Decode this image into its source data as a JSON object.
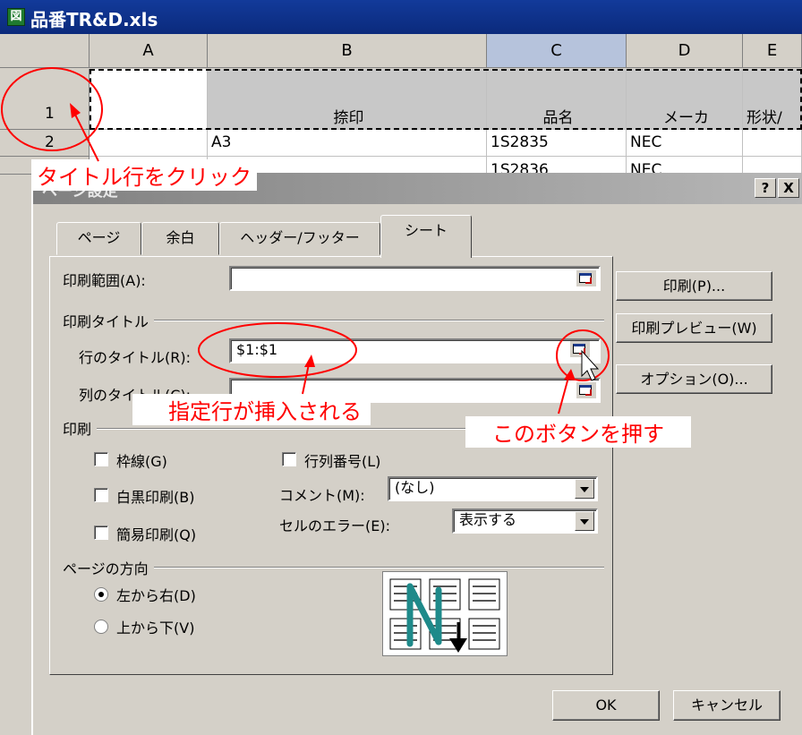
{
  "window": {
    "title": "品番TR&D.xls",
    "icon": "excel-icon"
  },
  "sheet": {
    "columns": [
      "A",
      "B",
      "C",
      "D",
      "E"
    ],
    "rows": [
      {
        "num": "1",
        "cells": [
          "",
          "捺印",
          "品名",
          "メーカ",
          "形状/"
        ]
      },
      {
        "num": "2",
        "cells": [
          "",
          "A3",
          "1S2835",
          "NEC",
          ""
        ]
      },
      {
        "num": "",
        "cells": [
          "",
          "",
          "1S2836",
          "NEC",
          ""
        ]
      }
    ]
  },
  "dialog": {
    "title": "ページ設定",
    "help_label": "?",
    "close_label": "X",
    "tabs": [
      "ページ",
      "余白",
      "ヘッダー/フッター",
      "シート"
    ],
    "active_tab": "シート",
    "print_area_label": "印刷範囲(A):",
    "print_area_value": "",
    "print_titles_group": "印刷タイトル",
    "rows_title_label": "行のタイトル(R):",
    "rows_title_value": "$1:$1",
    "cols_title_label": "列のタイトル(C):",
    "cols_title_value": "",
    "print_group": "印刷",
    "gridlines_label": "枠線(G)",
    "bw_label": "白黒印刷(B)",
    "draft_label": "簡易印刷(Q)",
    "rowcol_headings_label": "行列番号(L)",
    "comments_label": "コメント(M):",
    "comments_value": "(なし)",
    "cell_errors_label": "セルのエラー(E):",
    "cell_errors_value": "表示する",
    "page_order_group": "ページの方向",
    "left_to_right_label": "左から右(D)",
    "top_to_bottom_label": "上から下(V)",
    "left_to_right_selected": true,
    "print_button": "印刷(P)...",
    "preview_button": "印刷プレビュー(W)",
    "options_button": "オプション(O)...",
    "ok_button": "OK",
    "cancel_button": "キャンセル"
  },
  "annotations": {
    "click_title_row": "タイトル行をクリック",
    "row_inserted": "指定行が挿入される",
    "press_this_button": "このボタンを押す",
    "color": "#ff0000"
  }
}
